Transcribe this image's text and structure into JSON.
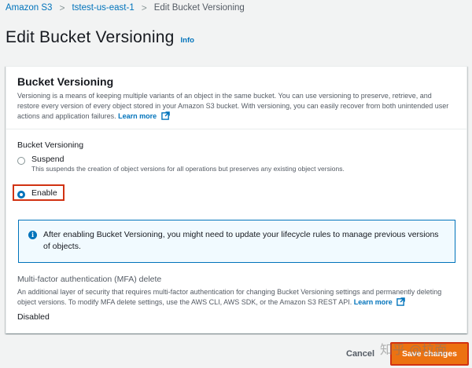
{
  "breadcrumb": {
    "items": [
      "Amazon S3",
      "tstest-us-east-1",
      "Edit Bucket Versioning"
    ],
    "separator": ">"
  },
  "page": {
    "title": "Edit Bucket Versioning",
    "info_link": "Info"
  },
  "panel": {
    "title": "Bucket Versioning",
    "description": "Versioning is a means of keeping multiple variants of an object in the same bucket. You can use versioning to preserve, retrieve, and restore every version of every object stored in your Amazon S3 bucket. With versioning, you can easily recover from both unintended user actions and application failures.",
    "learn_more": "Learn more",
    "field_label": "Bucket Versioning",
    "options": [
      {
        "label": "Suspend",
        "description": "This suspends the creation of object versions for all operations but preserves any existing object versions.",
        "checked": false
      },
      {
        "label": "Enable",
        "checked": true
      }
    ],
    "alert": {
      "icon": "info-icon",
      "text": "After enabling Bucket Versioning, you might need to update your lifecycle rules to manage previous versions of objects."
    },
    "mfa": {
      "title": "Multi-factor authentication (MFA) delete",
      "description": "An additional layer of security that requires multi-factor authentication for changing Bucket Versioning settings and permanently deleting object versions. To modify MFA delete settings, use the AWS CLI, AWS SDK, or the Amazon S3 REST API.",
      "learn_more": "Learn more",
      "value": "Disabled"
    }
  },
  "actions": {
    "cancel": "Cancel",
    "save": "Save changes"
  },
  "watermark": "知乎 @拉面",
  "colors": {
    "link": "#0073bb",
    "primary_button": "#ec7211",
    "highlight": "#d13212",
    "alert_bg": "#f1faff"
  }
}
